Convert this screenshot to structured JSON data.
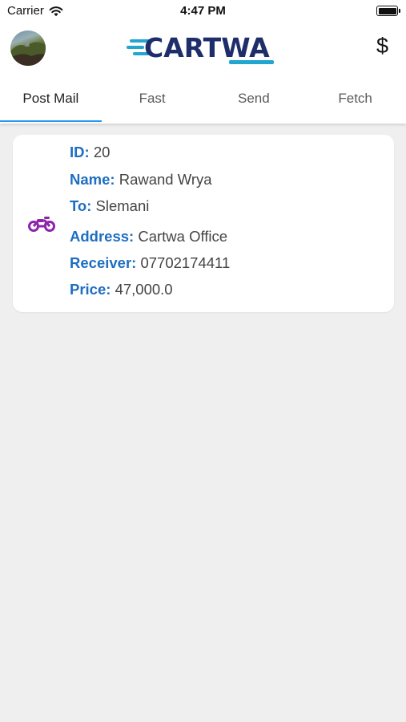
{
  "status_bar": {
    "carrier": "Carrier",
    "time": "4:47 PM"
  },
  "header": {
    "logo_text": "CARTWA",
    "currency_symbol": "$",
    "brand_color": "#1d2e6b",
    "accent_color": "#20a6cf"
  },
  "tabs": [
    {
      "label": "Post Mail",
      "active": true
    },
    {
      "label": "Fast",
      "active": false
    },
    {
      "label": "Send",
      "active": false
    },
    {
      "label": "Fetch",
      "active": false
    }
  ],
  "order": {
    "icon": "motorcycle-icon",
    "icon_color": "#8e24aa",
    "id_label": "ID:",
    "id_value": "20",
    "name_label": "Name:",
    "name_value": "Rawand Wrya",
    "to_label": "To:",
    "to_value": "Slemani",
    "address_label": "Address:",
    "address_value": "Cartwa Office",
    "receiver_label": "Receiver:",
    "receiver_value": "07702174411",
    "price_label": "Price:",
    "price_value": "47,000.0"
  }
}
